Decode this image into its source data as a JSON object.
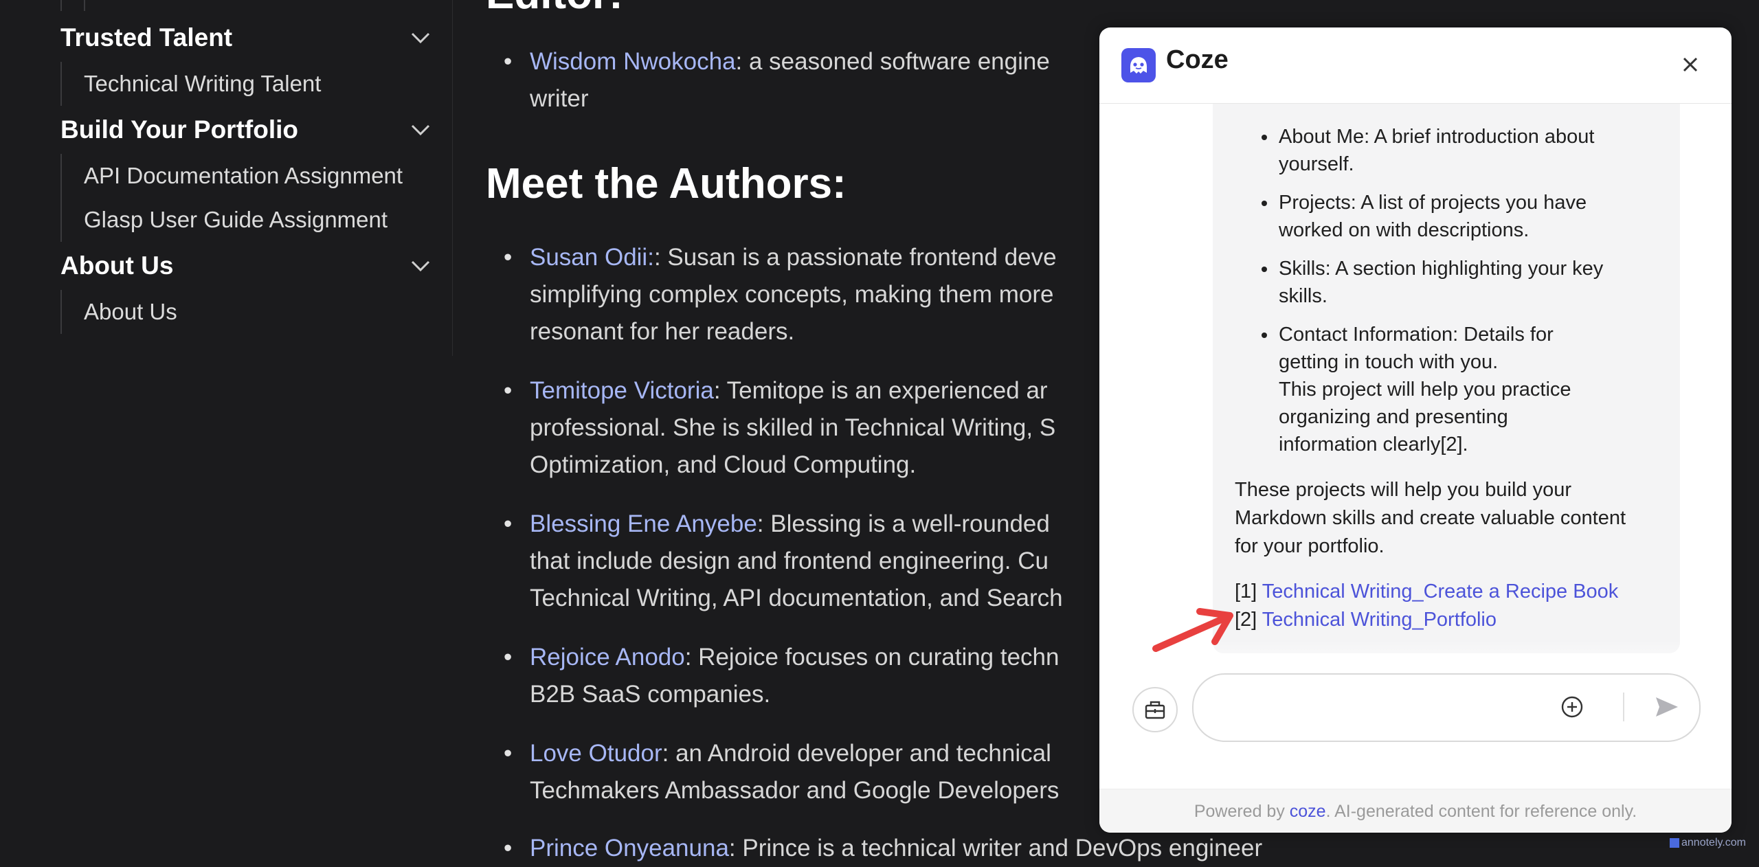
{
  "sidebar": {
    "categories": [
      {
        "label": "Trusted Talent",
        "links": [
          "Technical Writing Talent"
        ]
      },
      {
        "label": "Build Your Portfolio",
        "links": [
          "API Documentation Assignment",
          "Glasp User Guide Assignment"
        ]
      },
      {
        "label": "About Us",
        "links": [
          "About Us"
        ]
      }
    ]
  },
  "article": {
    "editor_heading": "Editor:",
    "editor_entry": {
      "name": "Wisdom Nwokocha",
      "line1": ": a seasoned software engine",
      "line2": "writer"
    },
    "authors_heading": "Meet the Authors:",
    "authors": [
      {
        "name": "Susan Odii:",
        "lines": [
          ": Susan is a passionate frontend deve",
          "simplifying complex concepts, making them more",
          "resonant for her readers."
        ]
      },
      {
        "name": "Temitope Victoria",
        "lines": [
          ": Temitope is an experienced ar",
          "professional. She is skilled in Technical Writing, S",
          "Optimization, and Cloud Computing."
        ]
      },
      {
        "name": "Blessing Ene Anyebe",
        "lines": [
          ": Blessing is a well-rounded ",
          "that include design and frontend engineering. Cu",
          "Technical Writing, API documentation, and Search"
        ]
      },
      {
        "name": "Rejoice Anodo",
        "lines": [
          ": Rejoice focuses on curating techn",
          "B2B SaaS companies."
        ]
      },
      {
        "name": "Love Otudor",
        "lines": [
          ": an Android developer and technical",
          "Techmakers Ambassador and Google Developers"
        ]
      },
      {
        "name": "Prince Onyeanuna",
        "lines": [
          ": Prince is a technical writer and DevOps engineer"
        ]
      }
    ]
  },
  "chat": {
    "title": "Coze",
    "bullets": [
      [
        "About Me: A brief introduction about",
        "yourself."
      ],
      [
        "Projects: A list of projects you have",
        "worked on with descriptions."
      ],
      [
        "Skills: A section highlighting your key",
        "skills."
      ],
      [
        "Contact Information: Details for",
        "getting in touch with you.",
        "This project will help you practice",
        "organizing and presenting",
        "information clearly[2]."
      ]
    ],
    "closing": [
      "These projects will help you build your",
      "Markdown skills and create valuable content",
      "for your portfolio."
    ],
    "references": [
      {
        "num": "[1]",
        "title": "Technical Writing_Create a Recipe Book"
      },
      {
        "num": "[2]",
        "title": "Technical Writing_Portfolio"
      }
    ],
    "input_placeholder": "",
    "footer_prefix": "Powered by ",
    "footer_brand": "coze",
    "footer_suffix": ". AI-generated content for reference only.",
    "accent_color": "#4d53e8"
  },
  "watermark": {
    "text": "annotely.com"
  },
  "colors": {
    "background": "#1b1b1d",
    "link": "#a7b7f5",
    "arrow": "#e8403f"
  }
}
